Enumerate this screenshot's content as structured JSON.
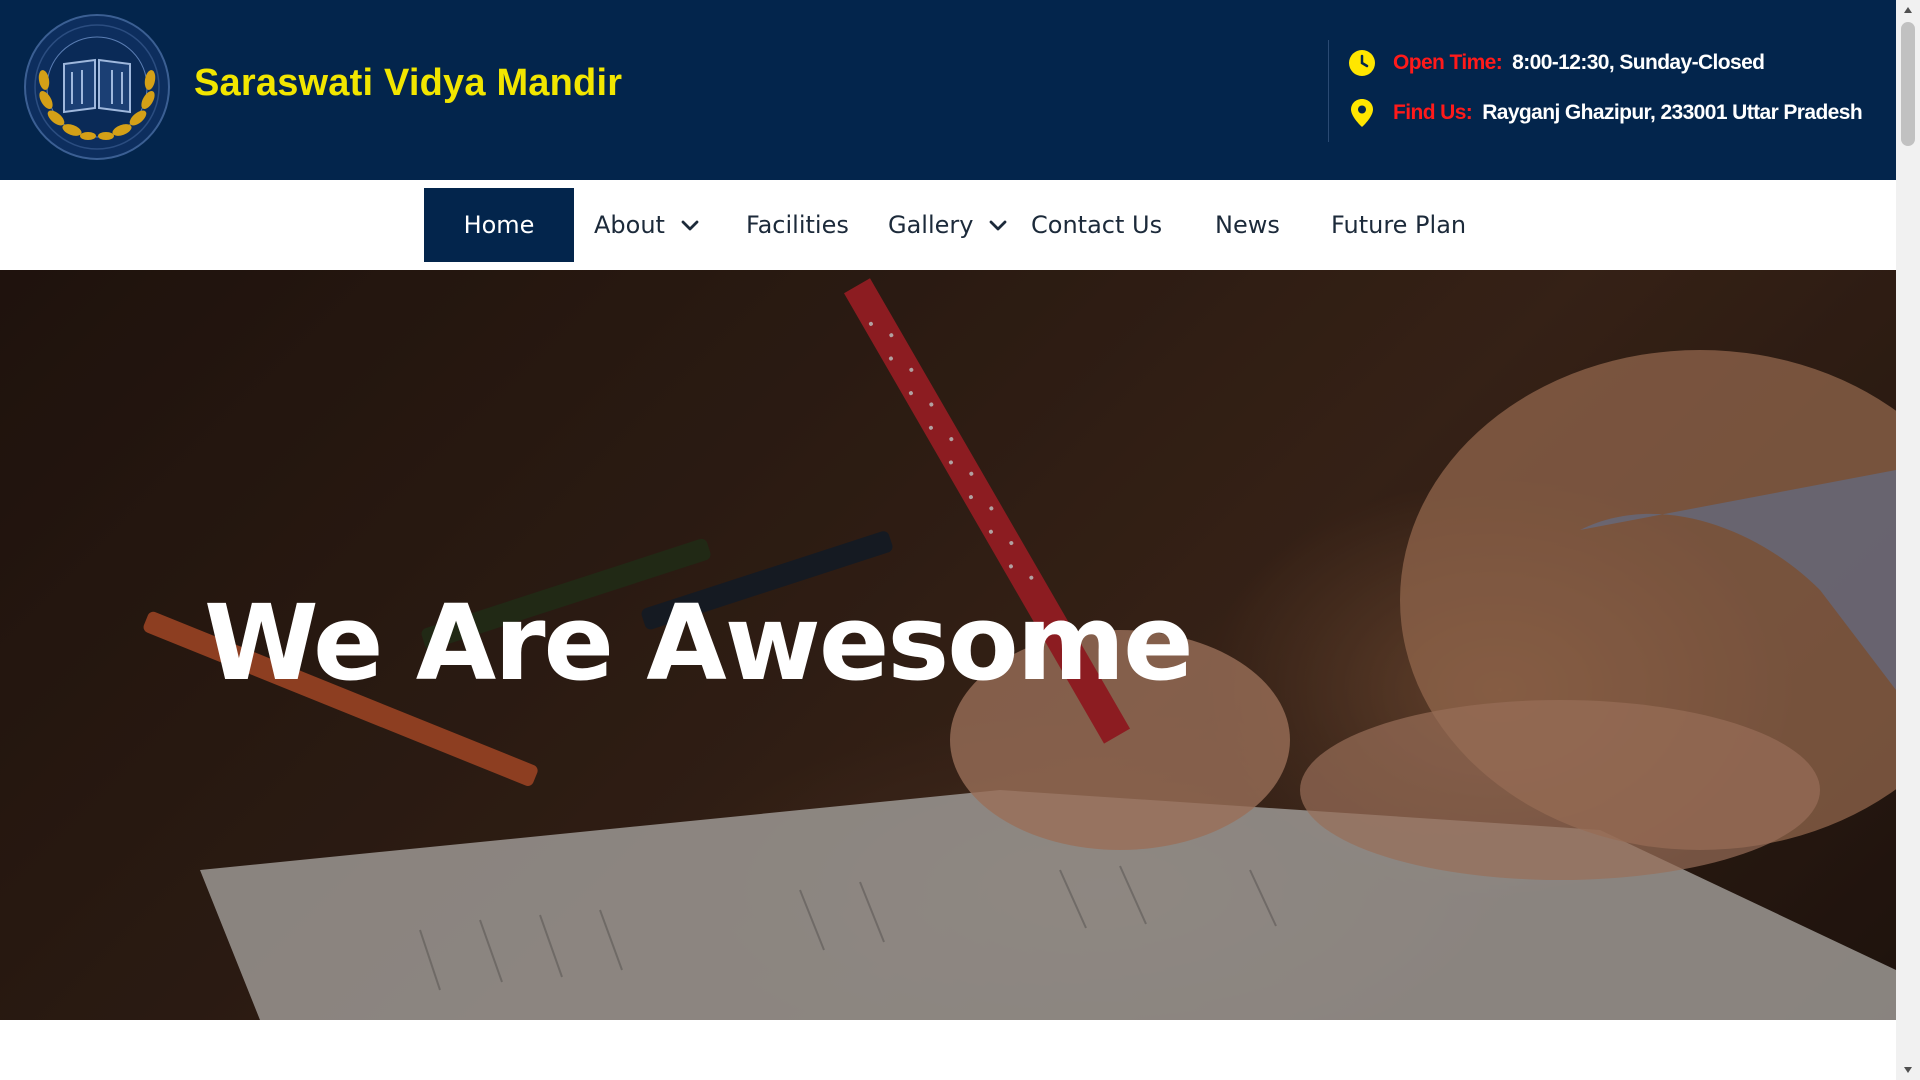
{
  "header": {
    "site_title": "Saraswati Vidya Mandir",
    "logo_icon": "school-crest-book-laurel",
    "open_time_label": "Open Time:",
    "open_time_value": "8:00-12:30, Sunday-Closed",
    "find_us_label": "Find Us:",
    "find_us_value": "Rayganj Ghazipur, 233001 Uttar Pradesh",
    "clock_icon": "clock-icon",
    "location_icon": "map-pin-icon"
  },
  "nav": {
    "items": [
      {
        "label": "Home",
        "active": true
      },
      {
        "label": "About",
        "has_dropdown": true
      },
      {
        "label": "Facilities"
      },
      {
        "label": "Gallery",
        "has_dropdown": true
      },
      {
        "label": "Contact Us"
      },
      {
        "label": "News"
      },
      {
        "label": "Future Plan"
      }
    ]
  },
  "hero": {
    "title": "We Are Awesome"
  },
  "colors": {
    "header_bg": "#03254c",
    "title_yellow": "#f2e600",
    "label_red": "#ff1a1a",
    "icon_yellow": "#ffe600",
    "nav_active_bg": "#03254c"
  }
}
